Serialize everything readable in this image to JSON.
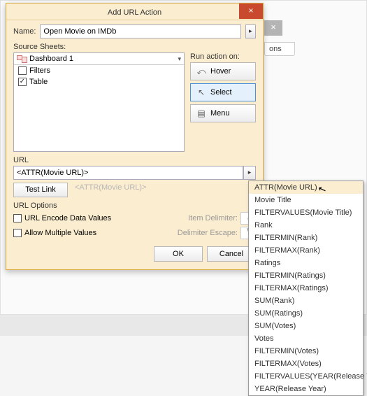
{
  "bg": {
    "ons": "ons"
  },
  "dialog": {
    "title": "Add URL Action",
    "name_label": "Name:",
    "name_value": "Open Movie on IMDb",
    "source_label": "Source Sheets:",
    "combo_value": "Dashboard 1",
    "checks": [
      {
        "label": "Filters",
        "checked": false
      },
      {
        "label": "Table",
        "checked": true
      }
    ],
    "run_label": "Run action on:",
    "run_buttons": [
      {
        "label": "Hover",
        "selected": false
      },
      {
        "label": "Select",
        "selected": true
      },
      {
        "label": "Menu",
        "selected": false
      }
    ],
    "url_label": "URL",
    "url_value": "<ATTR(Movie URL)>",
    "test_label": "Test Link",
    "url_hint": "<ATTR(Movie URL)>",
    "options_label": "URL Options",
    "opt1": "URL Encode Data Values",
    "opt2": "Allow Multiple Values",
    "item_delim_label": "Item Delimiter:",
    "item_delim_value": ",",
    "esc_label": "Delimiter Escape:",
    "esc_value": "\\",
    "ok": "OK",
    "cancel": "Cancel"
  },
  "dropdown": {
    "items": [
      "ATTR(Movie URL)",
      "Movie Title",
      "FILTERVALUES(Movie Title)",
      "Rank",
      "FILTERMIN(Rank)",
      "FILTERMAX(Rank)",
      "Ratings",
      "FILTERMIN(Ratings)",
      "FILTERMAX(Ratings)",
      "SUM(Rank)",
      "SUM(Ratings)",
      "SUM(Votes)",
      "Votes",
      "FILTERMIN(Votes)",
      "FILTERMAX(Votes)",
      "FILTERVALUES(YEAR(Release Year))",
      "YEAR(Release Year)"
    ],
    "hover_index": 0
  }
}
